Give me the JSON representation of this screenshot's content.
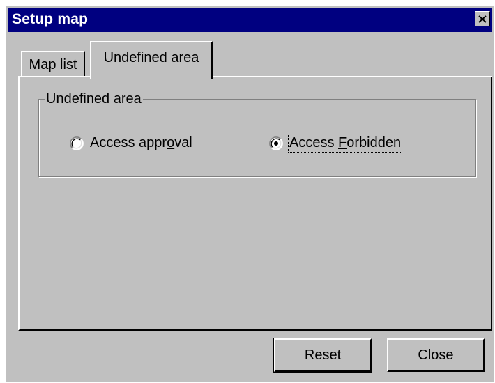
{
  "window": {
    "title": "Setup map"
  },
  "tabs": [
    {
      "label": "Map list",
      "active": false
    },
    {
      "label": "Undefined area",
      "active": true
    }
  ],
  "group": {
    "legend": "Undefined area",
    "options": [
      {
        "pre": "Access appr",
        "accel": "o",
        "post": "val",
        "selected": false
      },
      {
        "pre": "Access ",
        "accel": "F",
        "post": "orbidden",
        "selected": true
      }
    ]
  },
  "buttons": {
    "reset": "Reset",
    "close": "Close"
  },
  "colors": {
    "titlebar": "#000080",
    "face": "#c0c0c0"
  },
  "icons": {
    "close": "close-icon"
  }
}
